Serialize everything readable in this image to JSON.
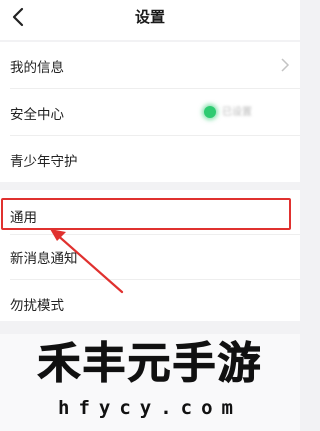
{
  "header": {
    "title": "设置",
    "back_icon": "chevron-left-icon"
  },
  "group1": {
    "items": [
      {
        "label": "我的信息",
        "icon": "chevron-right-icon"
      },
      {
        "label": "安全中心",
        "status_text": "已设置",
        "status_color": "#2ecb71"
      },
      {
        "label": "青少年守护"
      }
    ]
  },
  "group2": {
    "items": [
      {
        "label": "通用",
        "highlighted": true
      },
      {
        "label": "新消息通知"
      },
      {
        "label": "勿扰模式"
      }
    ]
  },
  "annotation": {
    "color": "#e0312f"
  },
  "watermark": {
    "title": "禾丰元手游",
    "url": "hfycy.com"
  }
}
